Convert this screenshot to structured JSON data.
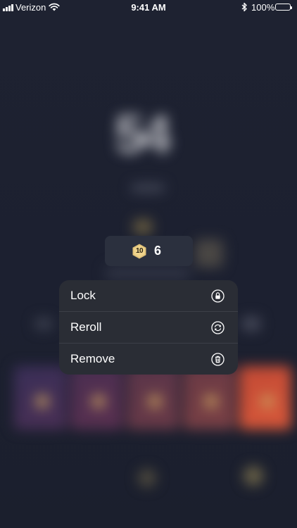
{
  "status_bar": {
    "carrier": "Verizon",
    "time": "9:41 AM",
    "battery_percent": "100%",
    "icons": [
      "signal-icon",
      "wifi-icon",
      "bluetooth-icon",
      "battery-icon"
    ]
  },
  "chip": {
    "badge": "10",
    "count": "6",
    "icon": "hexagon-level-badge-icon",
    "badge_color": "#e0c27a"
  },
  "menu": {
    "items": [
      {
        "label": "Lock",
        "icon": "lock-icon"
      },
      {
        "label": "Reroll",
        "icon": "reroll-icon"
      },
      {
        "label": "Remove",
        "icon": "trash-icon"
      }
    ]
  },
  "background": {
    "large_number": "54"
  }
}
